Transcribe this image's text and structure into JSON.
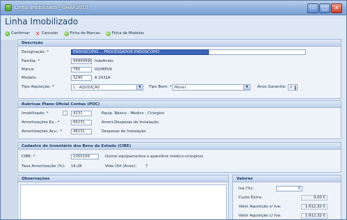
{
  "window": {
    "title": "Linha Imobilizado - GHAF2010",
    "controls": [
      "minimize",
      "maximize",
      "close"
    ]
  },
  "page": {
    "heading": "Linha Imobilizado"
  },
  "toolbar": {
    "confirm": "Confirmar",
    "cancel": "Cancelar",
    "brand_sheet": "Ficha de Marcas",
    "model_sheet": "Ficha de Modelos"
  },
  "description": {
    "section_title": "Descrição",
    "designation_label": "Designação: *",
    "designation_value": "ENDOSCÓPIO ... PROCESSADOR ENDOSCÓPIO",
    "family_label": "Família: *",
    "family_code": "99999999",
    "family_desc": "Indefinido",
    "brand_label": "Marca:",
    "brand_code": "790",
    "brand_desc": "OLYMPUS",
    "model_label": "Modelo:",
    "model_code": "3290",
    "model_desc": "A 2031A",
    "acq_type_label": "Tipo Aquisição: *",
    "acq_type_value": "1 - AQUISIÇÃO",
    "asset_type_label": "Tipo Bem: *",
    "asset_type_value": "Móvel",
    "warranty_label": "Anos Garantia:",
    "warranty_value": "0"
  },
  "poc": {
    "section_title": "Rubricas Plano Oficial Contas (POC)",
    "fixed_label": "Imobilizado: *",
    "fixed_code": "4231",
    "fixed_desc": "Equip. Básico - Médico - Cirúrgico",
    "amort_ex_label": "Amortizações Ex.: *",
    "amort_ex_code": "66231",
    "amort_ex_desc": "Amort.Despesas de Instalação",
    "amort_acu_label": "Amortizações Acu.: *",
    "amort_acu_code": "48231",
    "amort_acu_desc": "Despesas de Instalação"
  },
  "cibe": {
    "section_title": "Cadastro do Inventário dos Bens do Estado (CIBE)",
    "cibe_label": "CIBE: *",
    "cibe_code": "1050199",
    "cibe_desc": "Outros equipamentos e aparelhos médico-cirúrgicos",
    "rate_label": "Taxa Amortização (%):",
    "rate_value": "14,28",
    "life_label": "Vida Útil (Anos):",
    "life_value": "7"
  },
  "observations": {
    "section_title": "Observações"
  },
  "values": {
    "section_title": "Valores",
    "rows": [
      {
        "label": "Iva (%):",
        "value": "0"
      },
      {
        "label": "Custo Extra:",
        "value": "0,00 €"
      },
      {
        "label": "Valor Aquisição s/ Iva:",
        "value": "1.612,32 €"
      },
      {
        "label": "Valor Aquisição c/ Iva:",
        "value": "1.612,32 €"
      }
    ]
  }
}
